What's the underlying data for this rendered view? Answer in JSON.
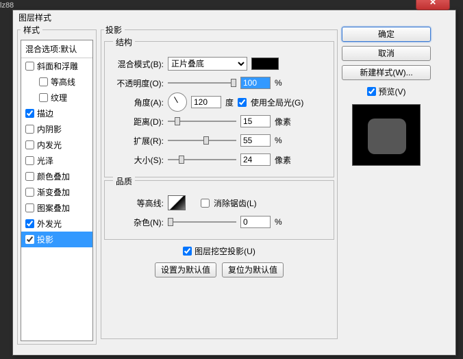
{
  "backdrop": "lz88",
  "window": {
    "title": "图层样式"
  },
  "sidebar": {
    "header": "样式",
    "defaults": "混合选项:默认",
    "items": [
      {
        "label": "斜面和浮雕",
        "checked": false,
        "indent": false
      },
      {
        "label": "等高线",
        "checked": false,
        "indent": true
      },
      {
        "label": "纹理",
        "checked": false,
        "indent": true
      },
      {
        "label": "描边",
        "checked": true,
        "indent": false
      },
      {
        "label": "内阴影",
        "checked": false,
        "indent": false
      },
      {
        "label": "内发光",
        "checked": false,
        "indent": false
      },
      {
        "label": "光泽",
        "checked": false,
        "indent": false
      },
      {
        "label": "颜色叠加",
        "checked": false,
        "indent": false
      },
      {
        "label": "渐变叠加",
        "checked": false,
        "indent": false
      },
      {
        "label": "图案叠加",
        "checked": false,
        "indent": false
      },
      {
        "label": "外发光",
        "checked": true,
        "indent": false
      },
      {
        "label": "投影",
        "checked": true,
        "indent": false,
        "selected": true
      }
    ]
  },
  "panel": {
    "title": "投影",
    "structure": {
      "legend": "结构",
      "blend_label": "混合模式(B):",
      "blend_value": "正片叠底",
      "opacity_label": "不透明度(O):",
      "opacity_value": "100",
      "opacity_unit": "%",
      "angle_label": "角度(A):",
      "angle_value": "120",
      "angle_unit": "度",
      "global_light_label": "使用全局光(G)",
      "global_light_checked": true,
      "distance_label": "距离(D):",
      "distance_value": "15",
      "distance_unit": "像素",
      "spread_label": "扩展(R):",
      "spread_value": "55",
      "spread_unit": "%",
      "size_label": "大小(S):",
      "size_value": "24",
      "size_unit": "像素"
    },
    "quality": {
      "legend": "品质",
      "contour_label": "等高线:",
      "antialias_label": "消除锯齿(L)",
      "antialias_checked": false,
      "noise_label": "杂色(N):",
      "noise_value": "0",
      "noise_unit": "%"
    },
    "knockout_label": "图层挖空投影(U)",
    "knockout_checked": true,
    "make_default": "设置为默认值",
    "reset_default": "复位为默认值"
  },
  "buttons": {
    "ok": "确定",
    "cancel": "取消",
    "new_style": "新建样式(W)...",
    "preview_label": "预览(V)",
    "preview_checked": true
  }
}
